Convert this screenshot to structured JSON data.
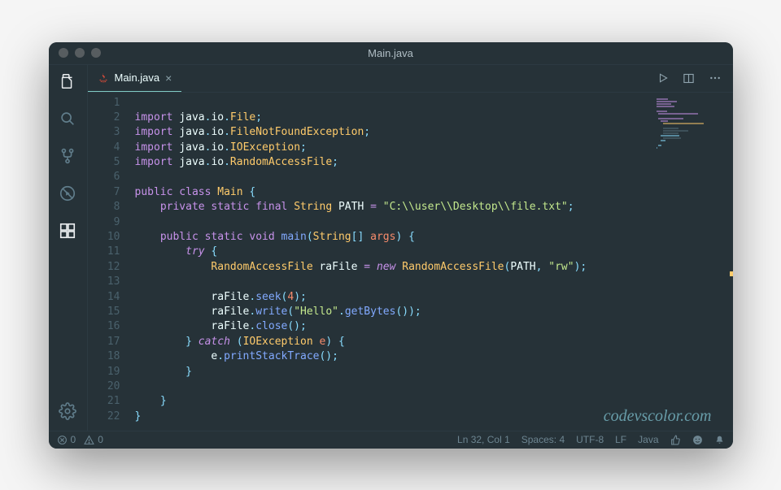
{
  "window": {
    "title": "Main.java"
  },
  "tab": {
    "filename": "Main.java",
    "close_glyph": "×"
  },
  "actions": {
    "run_title": "Run",
    "split_title": "Split Editor",
    "more_title": "More Actions"
  },
  "statusbar": {
    "errors": "0",
    "warnings": "0",
    "line_col": "Ln 32, Col 1",
    "spaces": "Spaces: 4",
    "encoding": "UTF-8",
    "eol": "LF",
    "language": "Java"
  },
  "watermark": "codevscolor.com",
  "code": {
    "lines": [
      {
        "n": 1,
        "t": []
      },
      {
        "n": 2,
        "t": [
          [
            "kw-import",
            "import"
          ],
          [
            "",
            ""
          ],
          [
            "pkg",
            " java"
          ],
          [
            "punct",
            "."
          ],
          [
            "pkg",
            "io"
          ],
          [
            "punct",
            "."
          ],
          [
            "cls",
            "File"
          ],
          [
            "punct",
            ";"
          ]
        ]
      },
      {
        "n": 3,
        "t": [
          [
            "kw-import",
            "import"
          ],
          [
            "pkg",
            " java"
          ],
          [
            "punct",
            "."
          ],
          [
            "pkg",
            "io"
          ],
          [
            "punct",
            "."
          ],
          [
            "cls",
            "FileNotFoundException"
          ],
          [
            "punct",
            ";"
          ]
        ]
      },
      {
        "n": 4,
        "t": [
          [
            "kw-import",
            "import"
          ],
          [
            "pkg",
            " java"
          ],
          [
            "punct",
            "."
          ],
          [
            "pkg",
            "io"
          ],
          [
            "punct",
            "."
          ],
          [
            "cls",
            "IOException"
          ],
          [
            "punct",
            ";"
          ]
        ]
      },
      {
        "n": 5,
        "t": [
          [
            "kw-import",
            "import"
          ],
          [
            "pkg",
            " java"
          ],
          [
            "punct",
            "."
          ],
          [
            "pkg",
            "io"
          ],
          [
            "punct",
            "."
          ],
          [
            "cls",
            "RandomAccessFile"
          ],
          [
            "punct",
            ";"
          ]
        ]
      },
      {
        "n": 6,
        "t": []
      },
      {
        "n": 7,
        "t": [
          [
            "kw-mod",
            "public "
          ],
          [
            "kw-type",
            "class "
          ],
          [
            "cls",
            "Main"
          ],
          [
            "",
            ""
          ],
          [
            "punct",
            " {"
          ]
        ]
      },
      {
        "n": 8,
        "t": [
          [
            "",
            "    "
          ],
          [
            "kw-mod",
            "private static final "
          ],
          [
            "cls",
            "String"
          ],
          [
            "const",
            " PATH"
          ],
          [
            "op",
            " = "
          ],
          [
            "str",
            "\"C:\\\\user\\\\Desktop\\\\file.txt\""
          ],
          [
            "punct",
            ";"
          ]
        ]
      },
      {
        "n": 9,
        "t": []
      },
      {
        "n": 10,
        "t": [
          [
            "",
            "    "
          ],
          [
            "kw-mod",
            "public static "
          ],
          [
            "kw-type",
            "void "
          ],
          [
            "fn",
            "main"
          ],
          [
            "punct",
            "("
          ],
          [
            "cls",
            "String"
          ],
          [
            "punct",
            "[] "
          ],
          [
            "param",
            "args"
          ],
          [
            "punct",
            ") {"
          ]
        ]
      },
      {
        "n": 11,
        "t": [
          [
            "",
            "        "
          ],
          [
            "kw-ctrl",
            "try"
          ],
          [
            "punct",
            " {"
          ]
        ]
      },
      {
        "n": 12,
        "t": [
          [
            "",
            "            "
          ],
          [
            "cls",
            "RandomAccessFile"
          ],
          [
            "var",
            " raFile"
          ],
          [
            "op",
            " = "
          ],
          [
            "kw-new",
            "new "
          ],
          [
            "cls",
            "RandomAccessFile"
          ],
          [
            "punct",
            "("
          ],
          [
            "const",
            "PATH"
          ],
          [
            "punct",
            ", "
          ],
          [
            "str",
            "\"rw\""
          ],
          [
            "punct",
            ");"
          ]
        ]
      },
      {
        "n": 13,
        "t": []
      },
      {
        "n": 14,
        "t": [
          [
            "",
            "            "
          ],
          [
            "var",
            "raFile"
          ],
          [
            "punct",
            "."
          ],
          [
            "fn",
            "seek"
          ],
          [
            "punct",
            "("
          ],
          [
            "num",
            "4"
          ],
          [
            "punct",
            ");"
          ]
        ]
      },
      {
        "n": 15,
        "t": [
          [
            "",
            "            "
          ],
          [
            "var",
            "raFile"
          ],
          [
            "punct",
            "."
          ],
          [
            "fn",
            "write"
          ],
          [
            "punct",
            "("
          ],
          [
            "str",
            "\"Hello\""
          ],
          [
            "punct",
            "."
          ],
          [
            "fn",
            "getBytes"
          ],
          [
            "punct",
            "());"
          ]
        ]
      },
      {
        "n": 16,
        "t": [
          [
            "",
            "            "
          ],
          [
            "var",
            "raFile"
          ],
          [
            "punct",
            "."
          ],
          [
            "fn",
            "close"
          ],
          [
            "punct",
            "();"
          ]
        ]
      },
      {
        "n": 17,
        "t": [
          [
            "",
            "        "
          ],
          [
            "punct",
            "} "
          ],
          [
            "kw-ctrl",
            "catch"
          ],
          [
            "punct",
            " ("
          ],
          [
            "cls",
            "IOException"
          ],
          [
            "param",
            " e"
          ],
          [
            "punct",
            ") {"
          ]
        ]
      },
      {
        "n": 18,
        "t": [
          [
            "",
            "            "
          ],
          [
            "var",
            "e"
          ],
          [
            "punct",
            "."
          ],
          [
            "fn",
            "printStackTrace"
          ],
          [
            "punct",
            "();"
          ]
        ]
      },
      {
        "n": 19,
        "t": [
          [
            "",
            "        "
          ],
          [
            "punct",
            "}"
          ]
        ]
      },
      {
        "n": 20,
        "t": []
      },
      {
        "n": 21,
        "t": [
          [
            "",
            "    "
          ],
          [
            "punct",
            "}"
          ]
        ]
      },
      {
        "n": 22,
        "t": [
          [
            "punct",
            "}"
          ]
        ]
      }
    ]
  },
  "colors": {
    "bg": "#263238",
    "accent": "#80cbc4"
  }
}
